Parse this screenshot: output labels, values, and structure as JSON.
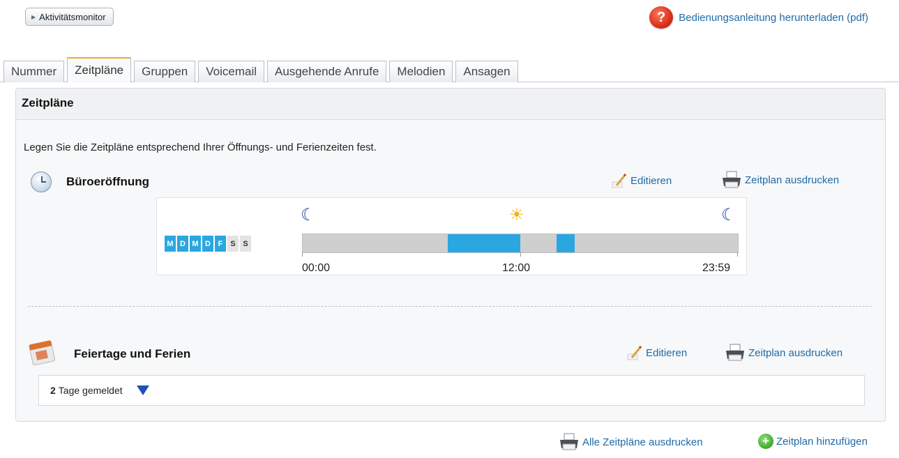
{
  "toolbar": {
    "monitor_label": "Aktivitätsmonitor",
    "help_link": "Bedienungsanleitung herunterladen (pdf)",
    "help_icon_glyph": "?"
  },
  "tabs": [
    {
      "label": "Nummer",
      "active": false
    },
    {
      "label": "Zeitpläne",
      "active": true
    },
    {
      "label": "Gruppen",
      "active": false
    },
    {
      "label": "Voicemail",
      "active": false
    },
    {
      "label": "Ausgehende Anrufe",
      "active": false
    },
    {
      "label": "Melodien",
      "active": false
    },
    {
      "label": "Ansagen",
      "active": false
    }
  ],
  "panel": {
    "title": "Zeitpläne",
    "intro": "Legen Sie die Zeitpläne entsprechend Ihrer Öffnungs- und Ferienzeiten fest."
  },
  "office": {
    "title": "Büroeröffnung",
    "edit_label": "Editieren",
    "print_label": "Zeitplan ausdrucken",
    "days": [
      {
        "label": "M",
        "active": true
      },
      {
        "label": "D",
        "active": true
      },
      {
        "label": "M",
        "active": true
      },
      {
        "label": "D",
        "active": true
      },
      {
        "label": "F",
        "active": true
      },
      {
        "label": "S",
        "active": false
      },
      {
        "label": "S",
        "active": false
      }
    ],
    "time_start": "00:00",
    "time_mid": "12:00",
    "time_end": "23:59",
    "open_segments": [
      {
        "from": "08:00",
        "to": "12:00"
      },
      {
        "from": "14:00",
        "to": "15:00"
      }
    ]
  },
  "holidays": {
    "title": "Feiertage und Ferien",
    "edit_label": "Editieren",
    "print_label": "Zeitplan ausdrucken",
    "count": "2",
    "count_label": "Tage gemeldet"
  },
  "footer": {
    "print_all_label": "Alle Zeitpläne ausdrucken",
    "add_label": "Zeitplan hinzufügen"
  },
  "colors": {
    "accent_blue": "#2aa7e0",
    "link": "#1e6aa8",
    "tab_active_top": "#f0a830"
  }
}
